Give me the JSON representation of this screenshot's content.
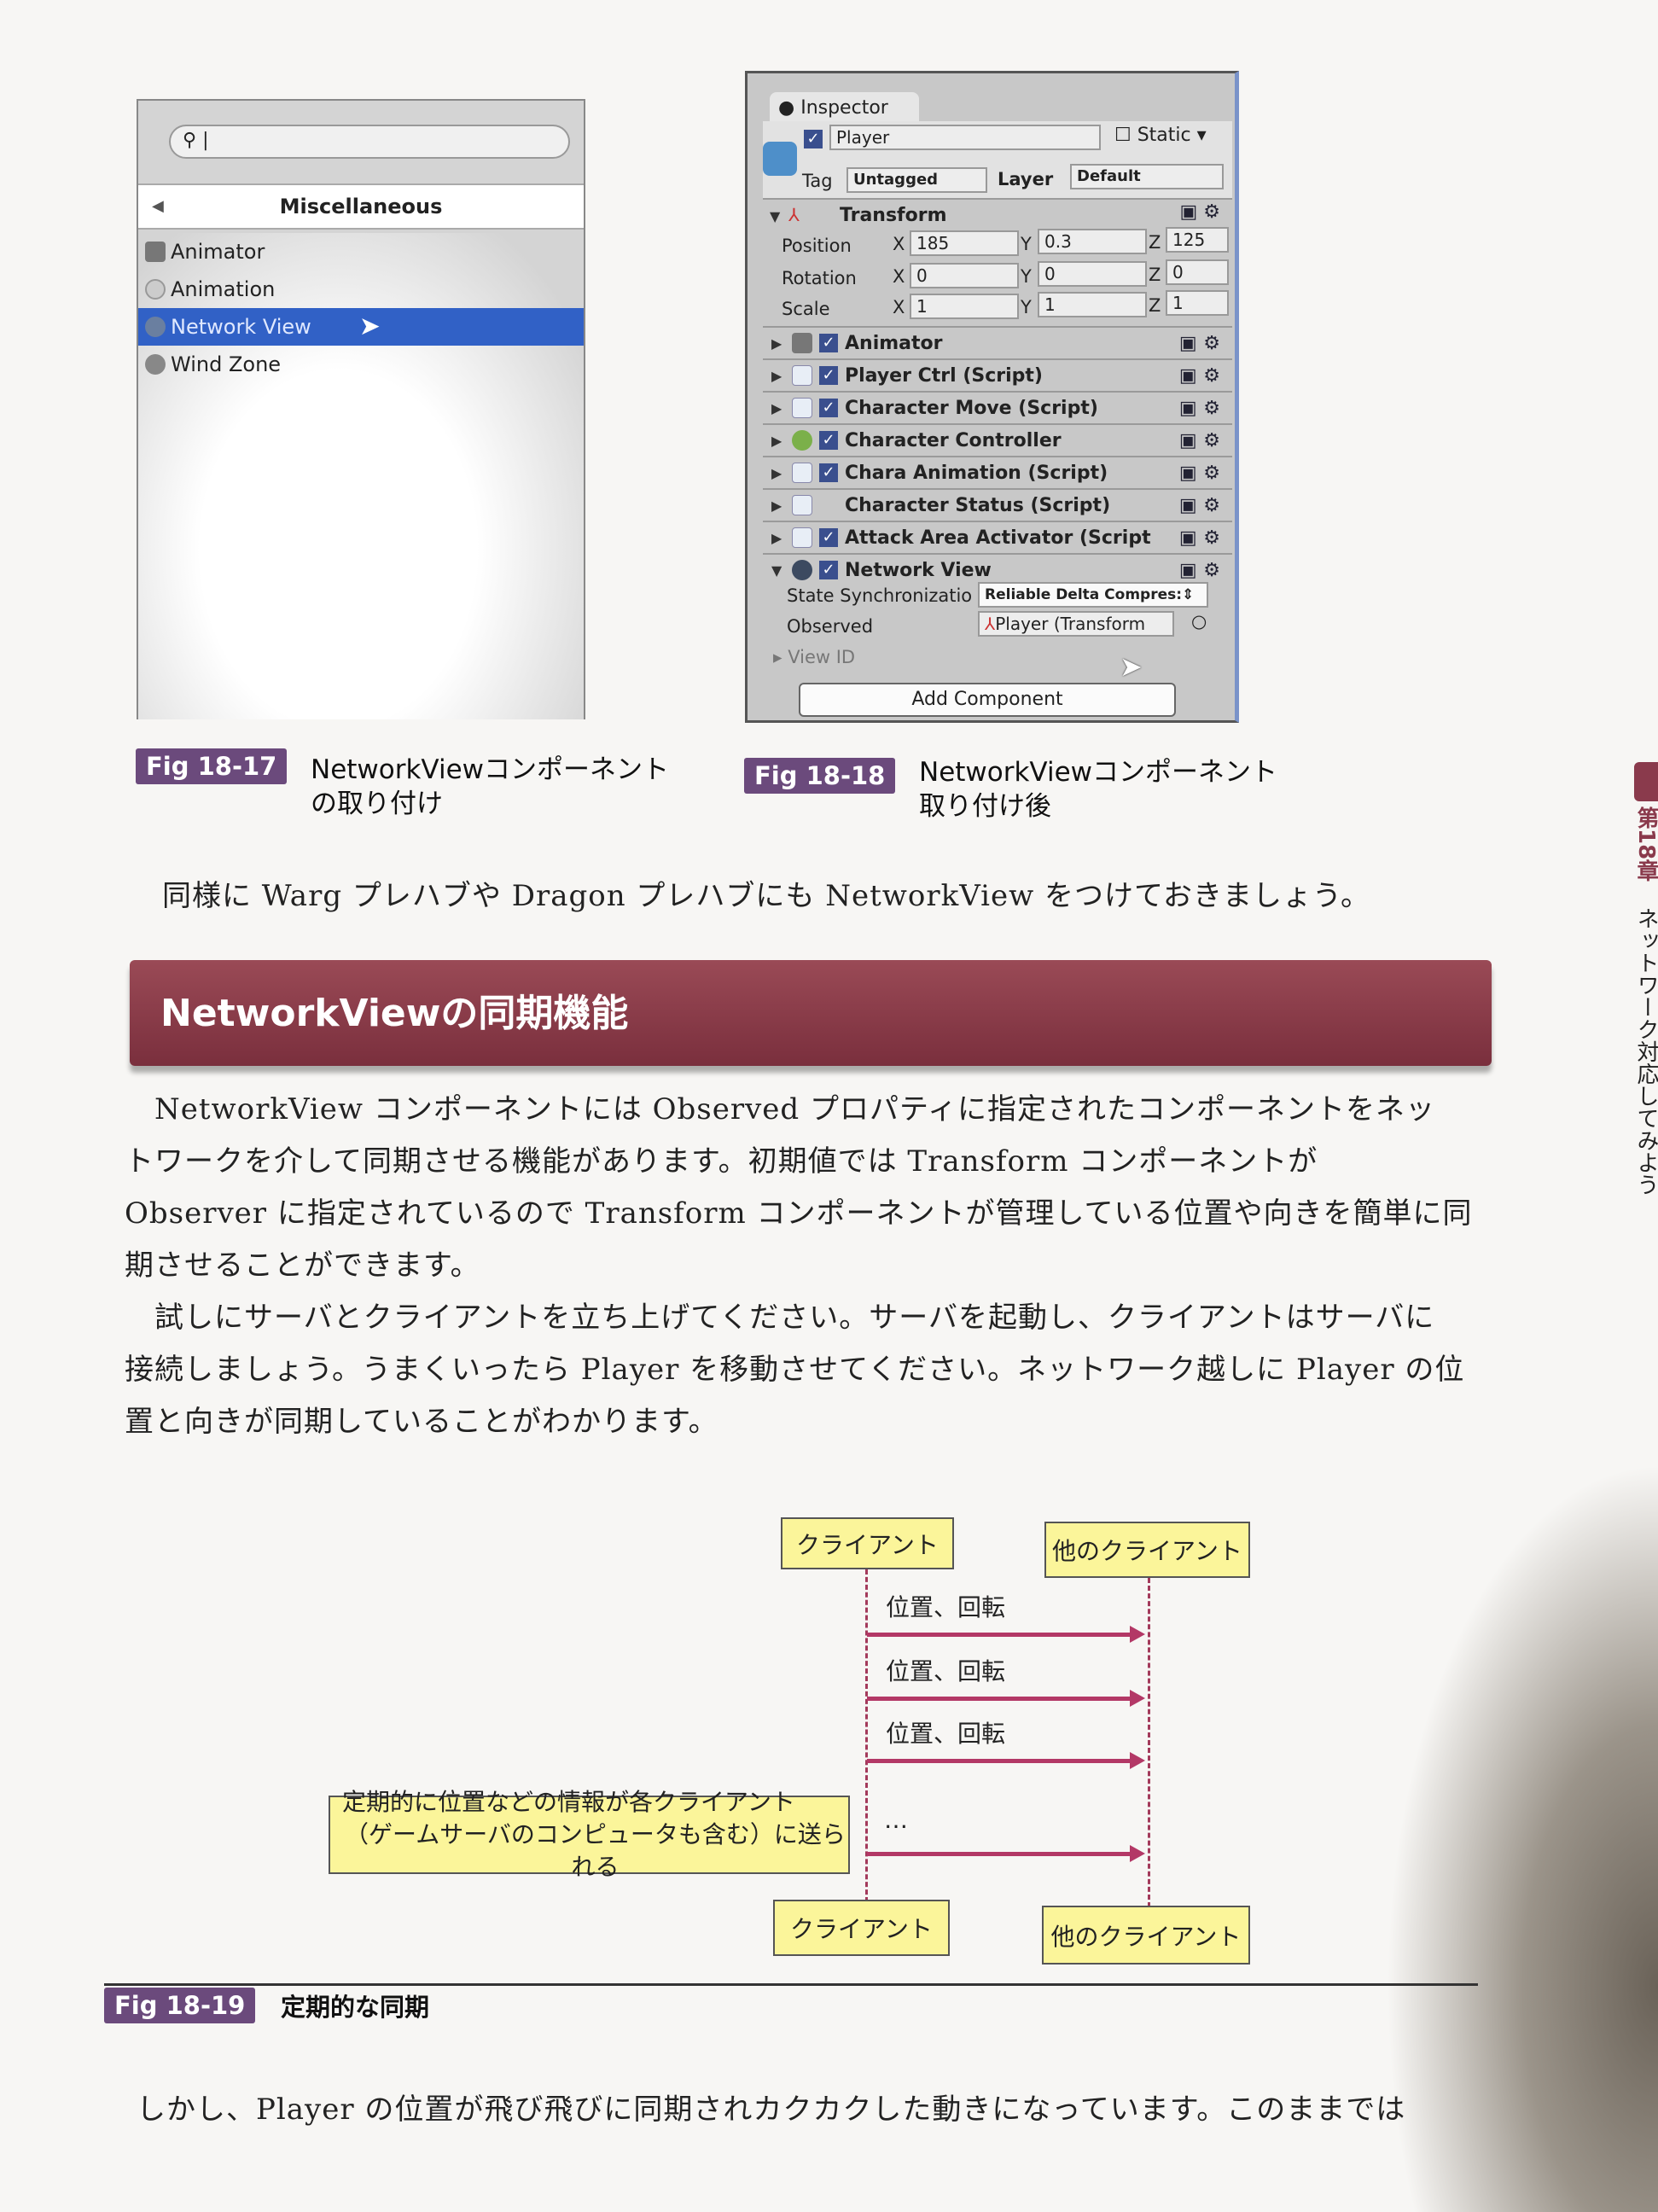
{
  "component_menu": {
    "search_placeholder": "",
    "header": "Miscellaneous",
    "items": [
      {
        "label": "Animator",
        "selected": false
      },
      {
        "label": "Animation",
        "selected": false
      },
      {
        "label": "Network View",
        "selected": true
      },
      {
        "label": "Wind Zone",
        "selected": false
      }
    ]
  },
  "inspector": {
    "tab": "Inspector",
    "object_name": "Player",
    "static_label": "Static",
    "tag_label": "Tag",
    "tag_value": "Untagged",
    "layer_label": "Layer",
    "layer_value": "Default",
    "transform": {
      "title": "Transform",
      "rows": [
        {
          "label": "Position",
          "x": "185",
          "y": "0.3",
          "z": "125"
        },
        {
          "label": "Rotation",
          "x": "0",
          "y": "0",
          "z": "0"
        },
        {
          "label": "Scale",
          "x": "1",
          "y": "1",
          "z": "1"
        }
      ]
    },
    "components": [
      {
        "name": "Animator",
        "enabled": true
      },
      {
        "name": "Player Ctrl (Script)",
        "enabled": true
      },
      {
        "name": "Character Move (Script)",
        "enabled": true
      },
      {
        "name": "Character Controller",
        "enabled": true
      },
      {
        "name": "Chara Animation (Script)",
        "enabled": true
      },
      {
        "name": "Character Status (Script)",
        "enabled": false
      },
      {
        "name": "Attack Area Activator (Script",
        "enabled": true
      },
      {
        "name": "Network View",
        "enabled": true
      }
    ],
    "network_view": {
      "state_sync_label": "State Synchronizatio",
      "state_sync_value": "Reliable Delta Compres:",
      "observed_label": "Observed",
      "observed_value": "Player (Transform",
      "view_id_label": "View ID"
    },
    "add_component": "Add Component"
  },
  "fig17": {
    "badge": "Fig 18-17",
    "caption1": "NetworkViewコンポーネント",
    "caption2": "の取り付け"
  },
  "fig18": {
    "badge": "Fig 18-18",
    "caption1": "NetworkViewコンポーネント",
    "caption2": "取り付け後"
  },
  "para1": "同様に Warg プレハブや Dragon プレハブにも NetworkView をつけておきましょう。",
  "heading": "NetworkViewの同期機能",
  "para2": [
    "　NetworkView コンポーネントには Observed プロパティに指定されたコンポーネントをネッ",
    "トワークを介して同期させる機能があります。初期値では Transform コンポーネントが",
    "Observer に指定されているので Transform コンポーネントが管理している位置や向きを簡単に同",
    "期させることができます。"
  ],
  "para3": [
    "　試しにサーバとクライアントを立ち上げてください。サーバを起動し、クライアントはサーバに",
    "接続しましょう。うまくいったら Player を移動させてください。ネットワーク越しに Player の位",
    "置と向きが同期していることがわかります。"
  ],
  "diagram": {
    "client": "クライアント",
    "other": "他のクライアント",
    "messages": [
      "位置、回転",
      "位置、回転",
      "位置、回転",
      "…"
    ],
    "note1": "定期的に位置などの情報が各クライアント",
    "note2": "（ゲームサーバのコンピュータも含む）に送られる",
    "arrow_color": "#b33866",
    "box_color": "#fbf59a"
  },
  "fig19": {
    "badge": "Fig 18-19",
    "caption": "定期的な同期"
  },
  "para4": "しかし、Player の位置が飛び飛びに同期されカクカクした動きになっています。このままでは",
  "side_tab": {
    "chapter": "第18章",
    "title": "ネットワーク対応してみよう"
  }
}
